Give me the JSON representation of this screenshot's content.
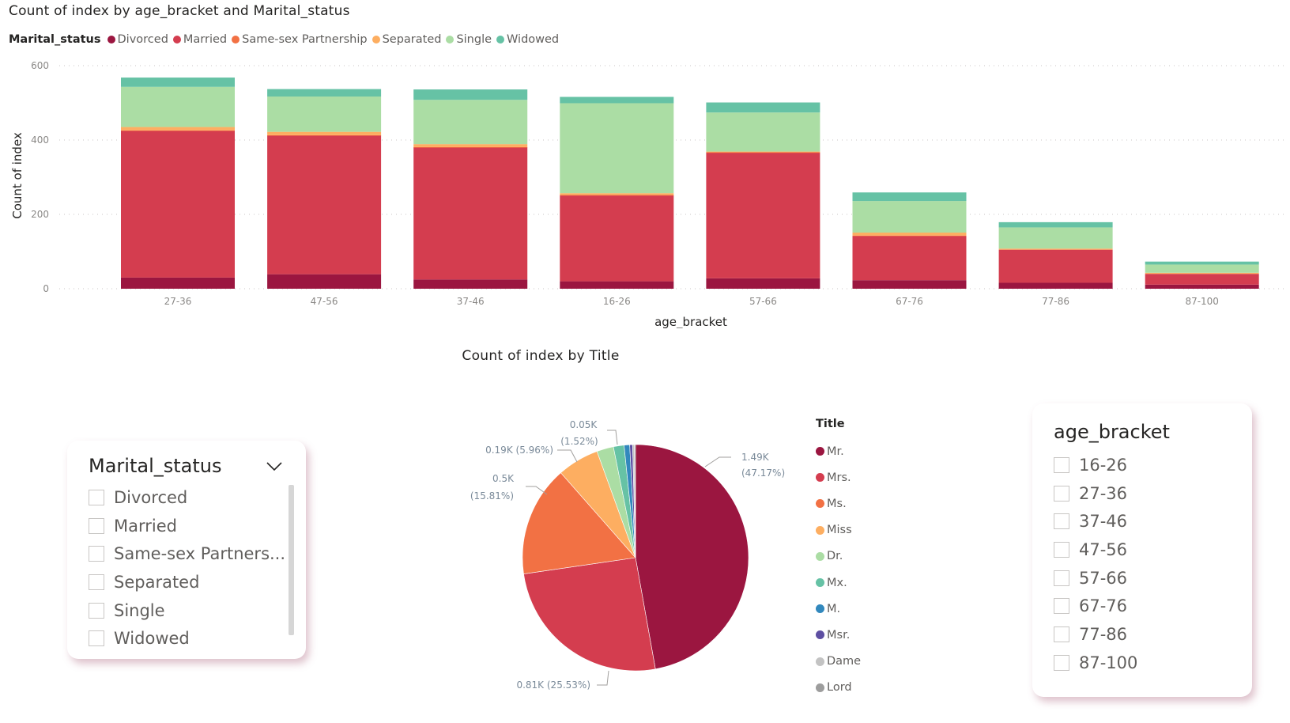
{
  "bar_chart": {
    "title": "Count of index by age_bracket and Marital_status",
    "legend_title": "Marital_status",
    "chart_data": {
      "type": "bar",
      "stacked": true,
      "title": "Count of index by age_bracket and Marital_status",
      "xlabel": "age_bracket",
      "ylabel": "Count of index",
      "ylim": [
        0,
        600
      ],
      "yticks": [
        0,
        200,
        400,
        600
      ],
      "grid": true,
      "legend_position": "top-left",
      "categories": [
        "27-36",
        "47-56",
        "37-46",
        "16-26",
        "57-66",
        "67-76",
        "77-86",
        "87-100"
      ],
      "series": [
        {
          "name": "Divorced",
          "color": "#9b1640",
          "values": [
            30,
            39,
            25,
            20,
            28,
            23,
            16,
            11
          ]
        },
        {
          "name": "Married",
          "color": "#d43d4f",
          "values": [
            395,
            373,
            355,
            231,
            338,
            119,
            89,
            29
          ]
        },
        {
          "name": "Same-sex Partnership",
          "color": "#f27144",
          "values": [
            1,
            1,
            1,
            1,
            1,
            1,
            0,
            0
          ]
        },
        {
          "name": "Separated",
          "color": "#fdae61",
          "values": [
            9,
            9,
            8,
            5,
            2,
            8,
            3,
            3
          ]
        },
        {
          "name": "Single",
          "color": "#abdda4",
          "values": [
            108,
            95,
            119,
            242,
            105,
            85,
            57,
            22
          ]
        },
        {
          "name": "Widowed",
          "color": "#66c2a5",
          "values": [
            25,
            20,
            28,
            17,
            27,
            23,
            14,
            8
          ]
        }
      ]
    }
  },
  "pie_chart": {
    "title": "Count of index by Title",
    "legend_title": "Title",
    "chart_data": {
      "type": "pie",
      "title": "Count of index by Title",
      "legend_position": "right",
      "labels": [
        "Mr.",
        "Mrs.",
        "Ms.",
        "Miss",
        "Dr.",
        "Mx.",
        "M.",
        "Msr.",
        "Dame",
        "Lord"
      ],
      "values": [
        1490,
        806,
        499,
        188,
        76,
        48,
        25,
        13,
        8,
        5
      ],
      "colors": [
        "#9b1640",
        "#d43d4f",
        "#f27144",
        "#fdae61",
        "#abdda4",
        "#66c2a5",
        "#3288bd",
        "#5e4fa2",
        "#c3c3c3",
        "#9d9d9d"
      ],
      "data_labels": [
        {
          "slice": "Mr.",
          "value": "1.49K",
          "percent": "(47.17%)"
        },
        {
          "slice": "Mrs.",
          "value": "0.81K",
          "percent": "(25.53%)"
        },
        {
          "slice": "Ms.",
          "value": "0.5K",
          "percent": "(15.81%)"
        },
        {
          "slice": "Miss",
          "value": "0.19K",
          "percent": "(5.96%)"
        },
        {
          "slice": "Mx.",
          "value": "0.05K",
          "percent": "(1.52%)"
        }
      ]
    }
  },
  "marital_slicer": {
    "title": "Marital_status",
    "items": [
      "Divorced",
      "Married",
      "Same-sex Partners...",
      "Separated",
      "Single",
      "Widowed"
    ]
  },
  "age_slicer": {
    "title": "age_bracket",
    "items": [
      "16-26",
      "27-36",
      "37-46",
      "47-56",
      "57-66",
      "67-76",
      "77-86",
      "87-100"
    ]
  }
}
